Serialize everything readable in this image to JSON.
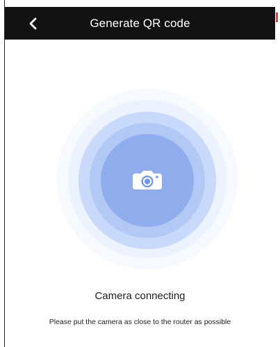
{
  "header": {
    "title": "Generate QR code",
    "back_icon": "chevron-left-icon"
  },
  "status": {
    "label": "Camera connecting",
    "hint": "Please put the camera as close to the router as possible"
  },
  "graphic": {
    "icon": "camera-icon",
    "colors": {
      "top_bar": "#121212",
      "ring_outer": "#f6f9ff",
      "ring_mid": "#ecf2ff",
      "ring_inner": "#c9d9fb",
      "ring_core": "#90aeee",
      "camera": "#ffffff",
      "lens": "#6f95e6"
    }
  }
}
